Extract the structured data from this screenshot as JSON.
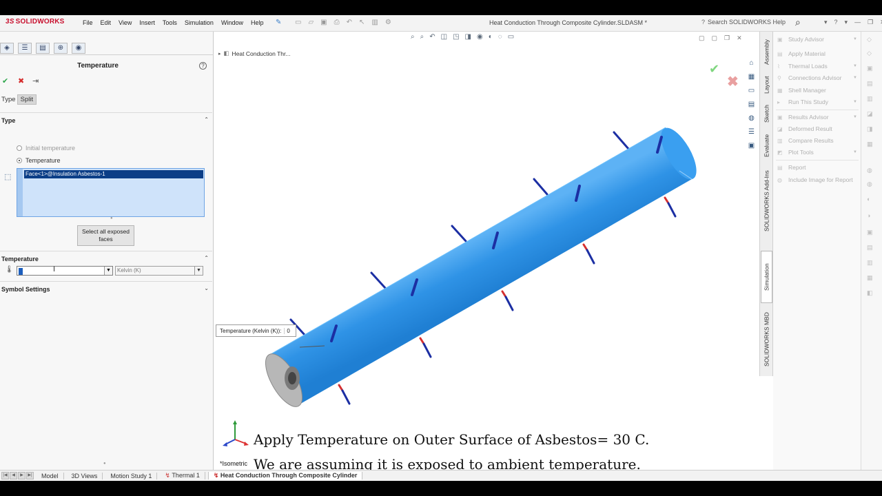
{
  "app": {
    "logo": "SOLIDWORKS",
    "logo_mark": "3S",
    "document_title": "Heat Conduction Through Composite Cylinder.SLDASM *",
    "help_search_placeholder": "Search SOLIDWORKS Help"
  },
  "menu": [
    "File",
    "Edit",
    "View",
    "Insert",
    "Tools",
    "Simulation",
    "Window",
    "Help"
  ],
  "property_manager": {
    "title": "Temperature",
    "subtabs": [
      "Type",
      "Split"
    ],
    "type_section": {
      "header": "Type",
      "options": [
        {
          "label": "Initial temperature",
          "selected": false
        },
        {
          "label": "Temperature",
          "selected": true
        }
      ]
    },
    "selection": {
      "items": [
        "Face<1>@Insulation Asbestos-1"
      ],
      "button": "Select all exposed faces"
    },
    "temperature_section": {
      "header": "Temperature",
      "value": "0",
      "unit": "Kelvin (K)"
    },
    "symbol_settings": {
      "header": "Symbol Settings"
    }
  },
  "graphics": {
    "tree_root": "Heat Conduction Thr...",
    "tooltip_label": "Temperature (Kelvin (K)):",
    "tooltip_value": "0",
    "view_label": "*Isometric",
    "captions": [
      "Apply Temperature on Outer Surface of Asbestos= 30 C.",
      "We are assuming it is exposed to ambient temperature."
    ],
    "colors": {
      "cylinder": "#2f93e6",
      "arrow_blue": "#1c2fa3",
      "arrow_red": "#d63030"
    }
  },
  "task_tabs": [
    "Assembly",
    "Layout",
    "Sketch",
    "Evaluate",
    "SOLIDWORKS Add-Ins",
    "Simulation",
    "SOLIDWORKS MBD"
  ],
  "simulation_commands": {
    "group1": [
      "Study Advisor",
      "Apply Material",
      "Thermal Loads",
      "Connections Advisor",
      "Shell Manager",
      "Run This Study"
    ],
    "group2": [
      "Results Advisor",
      "Deformed Result",
      "Compare Results",
      "Plot Tools"
    ],
    "group3": [
      "Report",
      "Include Image for Report"
    ]
  },
  "bottom_tabs": [
    "Model",
    "3D Views",
    "Motion Study 1",
    "Thermal 1",
    "Heat Conduction Through Composite Cylinder"
  ]
}
